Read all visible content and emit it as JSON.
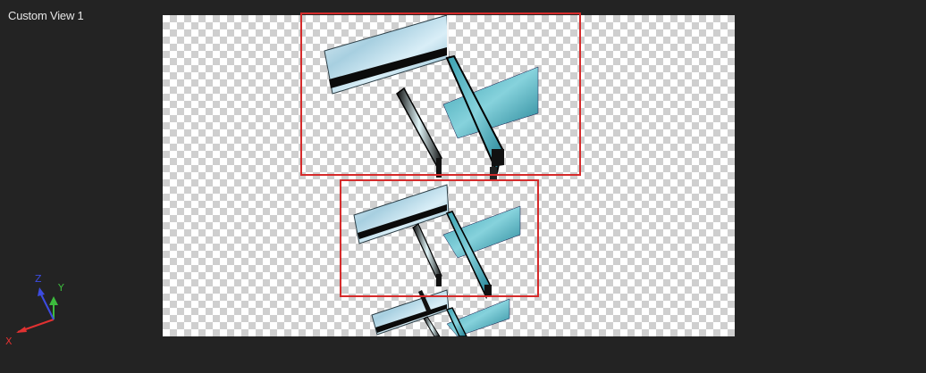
{
  "viewport": {
    "title": "Custom View 1"
  },
  "axes": {
    "x_label": "X",
    "y_label": "Y",
    "z_label": "Z",
    "x_color": "#e03131",
    "y_color": "#3dbb3d",
    "z_color": "#3c4be0"
  },
  "selection": {
    "outline_color": "#d52b2b",
    "count": 2
  },
  "model": {
    "copies": 3
  }
}
